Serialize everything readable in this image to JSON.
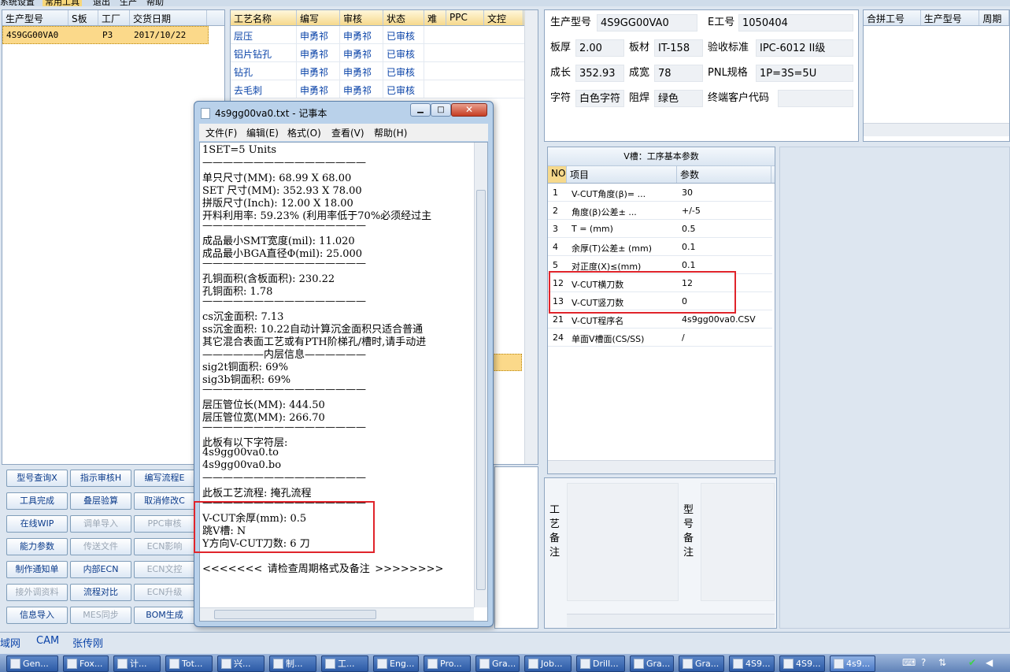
{
  "top_menu": [
    "系统设置",
    "常用工具",
    "退出",
    "生产",
    "帮助"
  ],
  "left_grid": {
    "headers": [
      "生产型号",
      "S板",
      "工厂",
      "交货日期"
    ],
    "rows": [
      [
        "4S9GG00VA0",
        "",
        "P3",
        "2017/10/22"
      ]
    ]
  },
  "process_grid": {
    "headers": [
      "工艺名称",
      "编写",
      "审核",
      "状态",
      "难",
      "PPC",
      "文控"
    ],
    "rows": [
      [
        "层压",
        "申勇祁",
        "申勇祁",
        "已审核"
      ],
      [
        "铝片钻孔",
        "申勇祁",
        "申勇祁",
        "已审核"
      ],
      [
        "钻孔",
        "申勇祁",
        "申勇祁",
        "已审核"
      ],
      [
        "去毛刺",
        "申勇祁",
        "申勇祁",
        "已审核"
      ]
    ]
  },
  "buttons": [
    "型号查询X",
    "指示审核H",
    "编写流程E",
    "工具完成",
    "叠层验算",
    "取消修改C",
    "在线WIP",
    "调单导入",
    "PPC审核",
    "能力参数",
    "传送文件",
    "ECN影响",
    "制作通知单",
    "内部ECN",
    "ECN文控",
    "接外调资料",
    "流程对比",
    "ECN升级",
    "信息导入",
    "MES同步",
    "BOM生成"
  ],
  "info": {
    "prod_model_label": "生产型号",
    "prod_model": "4S9GG00VA0",
    "eno_label": "E工号",
    "eno": "1050404",
    "thickness_label": "板厚",
    "thickness": "2.00",
    "material_label": "板材",
    "material": "IT-158",
    "standard_label": "验收标准",
    "standard": "IPC-6012 II级",
    "length_label": "成长",
    "length": "352.93",
    "width_label": "成宽",
    "width": "78",
    "pnl_label": "PNL规格",
    "pnl": "1P=3S=5U",
    "char_label": "字符",
    "char": "白色字符",
    "mask_label": "阻焊",
    "mask": "绿色",
    "customer_label": "终端客户代码",
    "customer": ""
  },
  "merge_grid": {
    "headers": [
      "合拼工号",
      "生产型号",
      "周期"
    ]
  },
  "vcut": {
    "title": "V槽：工序基本参数",
    "headers": [
      "NO",
      "项目",
      "参数"
    ],
    "rows": [
      [
        "1",
        "V-CUT角度(β)= ...",
        "30"
      ],
      [
        "2",
        "角度(β)公差± ...",
        "+/-5"
      ],
      [
        "3",
        "T = (mm)",
        "0.5"
      ],
      [
        "4",
        "余厚(T)公差± (mm)",
        "0.1"
      ],
      [
        "5",
        "对正度(X)≤(mm)",
        "0.1"
      ],
      [
        "12",
        "V-CUT横刀数",
        "12"
      ],
      [
        "13",
        "V-CUT竖刀数",
        "0"
      ],
      [
        "21",
        "V-CUT程序名",
        "4s9gg00va0.CSV"
      ],
      [
        "24",
        "单面V槽面(CS/SS)",
        "/"
      ]
    ]
  },
  "remark_labels": {
    "process": "工艺备注",
    "model": "型号备注"
  },
  "notepad": {
    "title": "4s9gg00va0.txt - 记事本",
    "menu": [
      "文件(F)",
      "编辑(E)",
      "格式(O)",
      "查看(V)",
      "帮助(H)"
    ],
    "lines": [
      "1SET=5 Units",
      "————————————————",
      "单只尺寸(MM): 68.99 X 68.00",
      "SET 尺寸(MM): 352.93 X 78.00",
      "拼版尺寸(Inch): 12.00 X 18.00",
      "开料利用率: 59.23% (利用率低于70%必须经过主",
      "————————————————",
      "成品最小SMT宽度(mil): 11.020",
      "成品最小BGA直径Φ(mil):  25.000",
      "————————————————",
      "孔铜面积(含板面积): 230.22",
      "孔铜面积: 1.78",
      "————————————————",
      "cs沉金面积: 7.13",
      "ss沉金面积: 10.22自动计算沉金面积只适合普通",
      "其它混合表面工艺或有PTH阶梯孔/槽时,请手动进",
      "——————内层信息——————",
      "sig2t铜面积: 69%",
      "sig3b铜面积: 69%",
      "————————————————",
      "层压管位长(MM): 444.50",
      "层压管位宽(MM): 266.70",
      "————————————————",
      "此板有以下字符层:",
      "4s9gg00va0.to",
      "4s9gg00va0.bo",
      "————————————————",
      "此板工艺流程: 掩孔流程",
      "————————————————",
      "V-CUT余厚(mm): 0.5",
      "跳V槽: N",
      "Y方向V-CUT刀数: 6 刀",
      "",
      "<<<<<<<_请检查周期格式及备注_>>>>>>>>"
    ]
  },
  "status_tabs": [
    "域网",
    "CAM",
    "张传刚"
  ],
  "taskbar": [
    "Gen...",
    "Fox...",
    "计...",
    "Tot...",
    "兴...",
    "制...",
    "工...",
    "Eng...",
    "Pro...",
    "Gra...",
    "Job...",
    "Drill...",
    "Gra...",
    "Gra...",
    "4S9...",
    "4S9...",
    "4s9..."
  ]
}
